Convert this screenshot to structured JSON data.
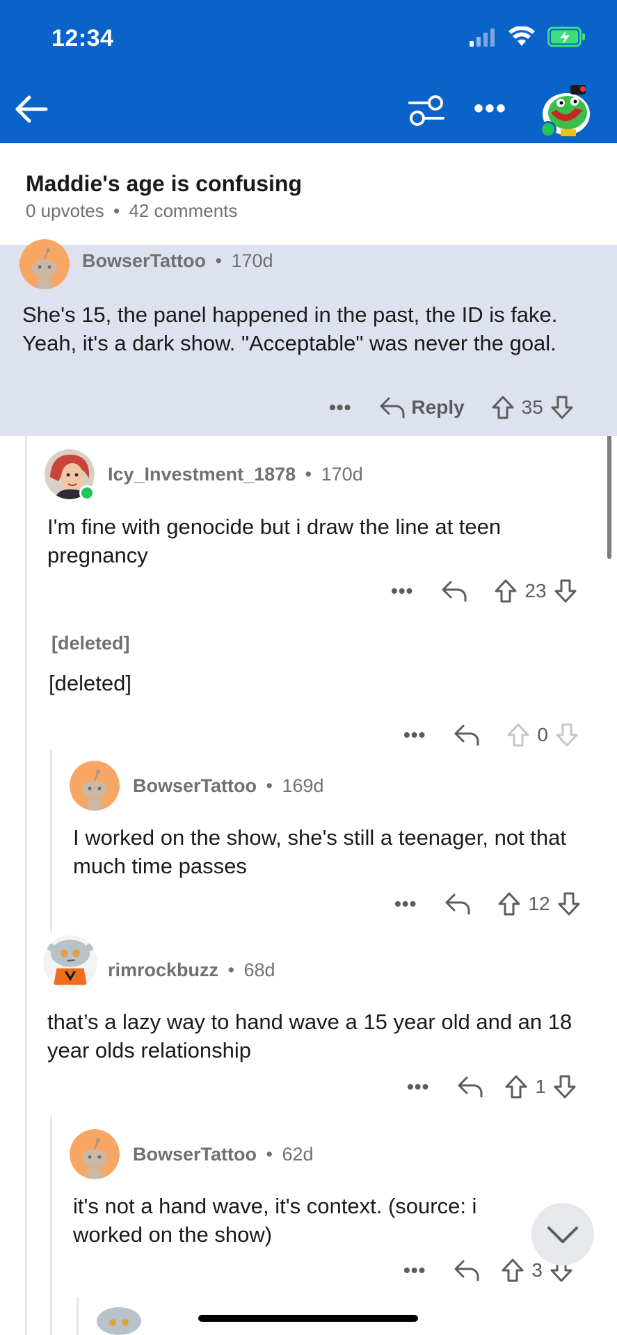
{
  "status_bar": {
    "time": "12:34"
  },
  "post": {
    "title": "Maddie's age is confusing",
    "upvotes": "0 upvotes",
    "comments": "42 comments"
  },
  "comments": [
    {
      "user": "BowserTattoo",
      "age": "170d",
      "body": "She's 15, the panel happened in the past, the ID is fake. Yeah, it's a dark show. \"Acceptable\" was never the goal.",
      "reply_label": "Reply",
      "votes": "35"
    },
    {
      "user": "Icy_Investment_1878",
      "age": "170d",
      "body": "I'm fine with genocide but i draw the line at teen pregnancy",
      "votes": "23"
    },
    {
      "user": "[deleted]",
      "body": "[deleted]",
      "votes": "0"
    },
    {
      "user": "BowserTattoo",
      "age": "169d",
      "body": "I worked on the show, she's still a teenager, not that much time passes",
      "votes": "12"
    },
    {
      "user": "rimrockbuzz",
      "age": "68d",
      "body": "that’s a lazy way to hand wave a 15 year old and an 18 year olds relationship",
      "votes": "1"
    },
    {
      "user": "BowserTattoo",
      "age": "62d",
      "body": "it's not a hand wave, it's context. (source: i worked on the show)",
      "votes": "3"
    }
  ],
  "colors": {
    "brand_blue": "#0a63c9",
    "highlight": "#dde2ee",
    "avatar_orange": "#f7a664",
    "online": "#21c35a"
  },
  "icons": [
    "back-arrow-icon",
    "filter-icon",
    "more-icon",
    "reply-icon",
    "upvote-icon",
    "downvote-icon",
    "chevron-down-icon",
    "signal-icon",
    "wifi-icon",
    "battery-icon"
  ]
}
